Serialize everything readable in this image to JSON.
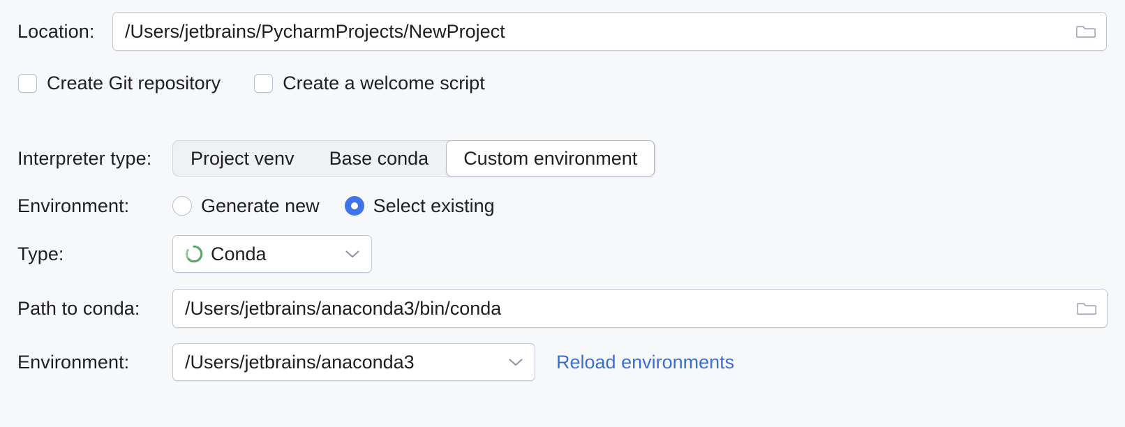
{
  "location": {
    "label": "Location:",
    "value": "/Users/jetbrains/PycharmProjects/NewProject",
    "browse_icon": "folder-icon"
  },
  "options": {
    "git": {
      "label": "Create Git repository",
      "checked": false
    },
    "welcome_script": {
      "label": "Create a welcome script",
      "checked": false
    }
  },
  "interpreter_type": {
    "label": "Interpreter type:",
    "segments": [
      {
        "label": "Project venv",
        "selected": false
      },
      {
        "label": "Base conda",
        "selected": false
      },
      {
        "label": "Custom environment",
        "selected": true
      }
    ]
  },
  "environment_mode": {
    "label": "Environment:",
    "options": [
      {
        "label": "Generate new",
        "selected": false
      },
      {
        "label": "Select existing",
        "selected": true
      }
    ]
  },
  "type": {
    "label": "Type:",
    "value": "Conda",
    "icon": "conda-icon",
    "chevron": "chevron-down-icon"
  },
  "path_to_conda": {
    "label": "Path to conda:",
    "value": "/Users/jetbrains/anaconda3/bin/conda",
    "browse_icon": "folder-icon"
  },
  "environment_select": {
    "label": "Environment:",
    "value": "/Users/jetbrains/anaconda3",
    "chevron": "chevron-down-icon",
    "reload_link": "Reload environments"
  },
  "colors": {
    "background": "#f7f8fa",
    "field_background": "#ffffff",
    "field_border": "#c3c6d4",
    "accent_blue": "#4173e8",
    "link_blue": "#3b6fd4",
    "conda_green": "#5aa96b",
    "text": "#1e1f22"
  }
}
